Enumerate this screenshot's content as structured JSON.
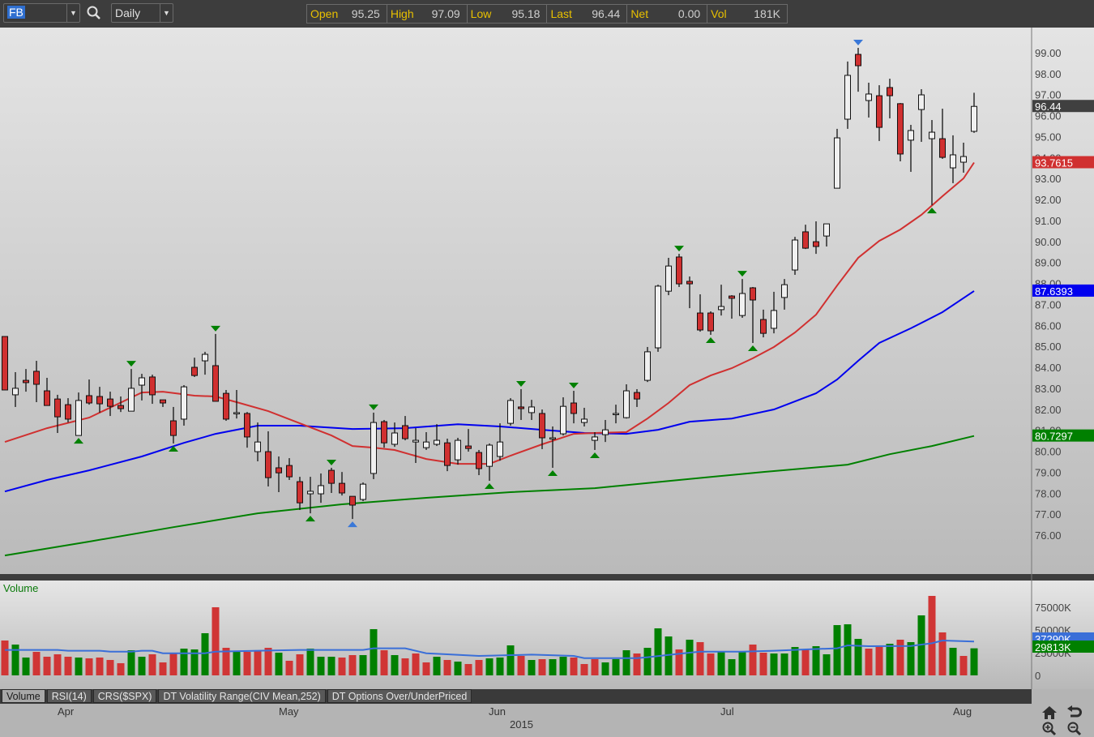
{
  "toolbar": {
    "symbol": "FB",
    "interval": "Daily",
    "quote": [
      {
        "label": "Open",
        "value": "95.25"
      },
      {
        "label": "High",
        "value": "97.09"
      },
      {
        "label": "Low",
        "value": "95.18"
      },
      {
        "label": "Last",
        "value": "96.44"
      },
      {
        "label": "Net",
        "value": "0.00"
      },
      {
        "label": "Vol",
        "value": "181K"
      }
    ]
  },
  "colors": {
    "up_candle": "#f0f0f0",
    "down_candle": "#d03030",
    "ma_fast": "#d03030",
    "ma_mid": "#0000ee",
    "ma_slow": "#008000",
    "vol_up": "#008000",
    "vol_down": "#d03535",
    "vol_ma": "#3a6fd8",
    "signal_green": "#008000",
    "signal_blue": "#3a78d8"
  },
  "chart_data": {
    "type": "candlestick",
    "symbol": "FB",
    "price_axis": {
      "ticks": [
        "99.00",
        "98.00",
        "97.00",
        "96.00",
        "95.00",
        "94.00",
        "93.00",
        "92.00",
        "91.00",
        "90.00",
        "89.00",
        "88.00",
        "87.00",
        "86.00",
        "85.00",
        "84.00",
        "83.00",
        "82.00",
        "81.00",
        "80.00",
        "79.00",
        "78.00",
        "77.00",
        "76.00"
      ],
      "range": [
        75.0,
        100.2
      ]
    },
    "x_axis": {
      "months": [
        "Apr",
        "May",
        "Jun",
        "Jul",
        "Aug"
      ],
      "year": "2015"
    },
    "badges": {
      "last": "96.44",
      "ma_fast": "93.7615",
      "ma_mid": "87.6393",
      "ma_slow": "80.7297",
      "vol_ma": "37290K",
      "vol_last": "29813K"
    },
    "ohlc": [
      [
        85.47,
        85.47,
        82.92,
        82.92
      ],
      [
        82.69,
        83.77,
        82.11,
        83.0
      ],
      [
        83.38,
        83.92,
        82.84,
        83.27
      ],
      [
        83.81,
        84.31,
        82.34,
        83.19
      ],
      [
        82.88,
        83.5,
        82.18,
        82.18
      ],
      [
        82.49,
        82.69,
        80.87,
        81.64
      ],
      [
        82.22,
        82.53,
        81.37,
        81.53
      ],
      [
        80.75,
        82.8,
        80.75,
        82.42
      ],
      [
        82.65,
        83.42,
        82.22,
        82.3
      ],
      [
        82.61,
        83.07,
        81.84,
        82.26
      ],
      [
        82.49,
        82.84,
        81.68,
        82.14
      ],
      [
        82.18,
        82.61,
        81.87,
        82.03
      ],
      [
        81.91,
        83.92,
        81.91,
        83.0
      ],
      [
        83.15,
        83.69,
        82.42,
        83.5
      ],
      [
        83.54,
        83.65,
        82.26,
        82.69
      ],
      [
        82.45,
        82.45,
        82.11,
        82.3
      ],
      [
        81.45,
        82.11,
        80.37,
        80.75
      ],
      [
        81.53,
        83.15,
        81.22,
        83.07
      ],
      [
        84.0,
        84.46,
        83.54,
        83.61
      ],
      [
        84.31,
        84.74,
        83.65,
        84.62
      ],
      [
        84.08,
        85.59,
        82.38,
        82.38
      ],
      [
        82.76,
        82.92,
        81.45,
        81.53
      ],
      [
        81.84,
        82.92,
        81.56,
        81.84
      ],
      [
        81.8,
        81.87,
        80.17,
        80.68
      ],
      [
        79.98,
        81.37,
        79.52,
        80.44
      ],
      [
        79.98,
        80.95,
        78.32,
        78.74
      ],
      [
        79.21,
        79.75,
        78.05,
        78.97
      ],
      [
        79.32,
        79.67,
        78.63,
        78.78
      ],
      [
        78.55,
        78.78,
        77.2,
        77.54
      ],
      [
        77.97,
        78.78,
        77.04,
        78.09
      ],
      [
        77.97,
        78.94,
        77.54,
        78.36
      ],
      [
        79.09,
        79.21,
        78.01,
        78.47
      ],
      [
        78.47,
        79.01,
        77.89,
        78.01
      ],
      [
        77.85,
        77.85,
        76.77,
        77.43
      ],
      [
        77.7,
        78.51,
        77.62,
        78.43
      ],
      [
        78.94,
        81.84,
        78.67,
        81.37
      ],
      [
        81.41,
        81.49,
        80.17,
        80.4
      ],
      [
        80.33,
        81.37,
        80.21,
        80.87
      ],
      [
        81.22,
        81.68,
        80.52,
        80.6
      ],
      [
        80.44,
        81.1,
        79.44,
        80.52
      ],
      [
        80.17,
        80.91,
        80.06,
        80.44
      ],
      [
        80.33,
        81.29,
        80.25,
        80.52
      ],
      [
        80.4,
        80.6,
        79.05,
        79.32
      ],
      [
        79.59,
        80.64,
        79.36,
        80.52
      ],
      [
        80.25,
        81.06,
        79.98,
        80.13
      ],
      [
        79.94,
        80.06,
        78.86,
        79.17
      ],
      [
        79.28,
        80.37,
        78.59,
        80.29
      ],
      [
        79.75,
        81.33,
        79.55,
        80.44
      ],
      [
        81.33,
        82.53,
        81.22,
        82.42
      ],
      [
        82.11,
        82.96,
        81.49,
        82.03
      ],
      [
        81.84,
        82.45,
        81.49,
        82.11
      ],
      [
        81.8,
        81.99,
        80.1,
        80.64
      ],
      [
        80.64,
        81.18,
        79.21,
        80.64
      ],
      [
        80.83,
        82.57,
        80.75,
        82.14
      ],
      [
        82.3,
        82.88,
        81.33,
        81.8
      ],
      [
        81.37,
        82.07,
        81.18,
        81.53
      ],
      [
        80.52,
        80.91,
        80.06,
        80.68
      ],
      [
        80.79,
        81.49,
        80.44,
        81.02
      ],
      [
        81.8,
        82.22,
        81.33,
        81.8
      ],
      [
        81.6,
        83.19,
        81.56,
        82.88
      ],
      [
        82.8,
        82.96,
        82.11,
        82.49
      ],
      [
        83.38,
        84.97,
        83.3,
        84.74
      ],
      [
        84.93,
        87.94,
        84.74,
        87.87
      ],
      [
        87.63,
        89.22,
        87.44,
        88.83
      ],
      [
        89.26,
        89.41,
        87.83,
        87.98
      ],
      [
        88.1,
        88.33,
        86.82,
        87.98
      ],
      [
        86.59,
        87.48,
        85.7,
        85.78
      ],
      [
        86.59,
        86.67,
        85.55,
        85.74
      ],
      [
        86.75,
        87.94,
        86.47,
        86.9
      ],
      [
        87.4,
        87.44,
        86.32,
        87.29
      ],
      [
        86.47,
        88.21,
        86.36,
        87.52
      ],
      [
        87.79,
        87.83,
        85.16,
        87.21
      ],
      [
        86.28,
        86.75,
        85.43,
        85.62
      ],
      [
        85.86,
        87.6,
        85.62,
        86.71
      ],
      [
        87.33,
        88.21,
        86.75,
        87.94
      ],
      [
        88.64,
        90.22,
        88.41,
        90.07
      ],
      [
        90.46,
        90.8,
        89.64,
        89.68
      ],
      [
        89.99,
        90.96,
        89.41,
        89.76
      ],
      [
        90.26,
        90.84,
        89.76,
        90.84
      ],
      [
        92.54,
        95.37,
        92.54,
        94.94
      ],
      [
        95.83,
        98.58,
        95.37,
        97.92
      ],
      [
        98.92,
        99.23,
        97.14,
        98.38
      ],
      [
        96.72,
        97.57,
        95.91,
        97.03
      ],
      [
        96.95,
        97.45,
        94.79,
        95.44
      ],
      [
        97.34,
        97.76,
        95.87,
        96.95
      ],
      [
        96.57,
        96.6,
        93.82,
        94.17
      ],
      [
        94.83,
        95.56,
        93.32,
        95.29
      ],
      [
        96.29,
        97.26,
        94.75,
        96.99
      ],
      [
        94.9,
        95.79,
        91.73,
        95.21
      ],
      [
        94.9,
        96.33,
        93.94,
        94.01
      ],
      [
        93.51,
        95.06,
        92.78,
        94.13
      ],
      [
        93.78,
        94.71,
        93.28,
        94.05
      ],
      [
        95.25,
        97.09,
        95.18,
        96.44
      ]
    ],
    "signals": {
      "top_green": [
        12,
        20,
        31,
        35,
        49,
        54,
        64,
        70
      ],
      "top_blue": [
        81
      ],
      "bottom_green": [
        7,
        16,
        29,
        46,
        52,
        56,
        67,
        71,
        88
      ],
      "bottom_blue": [
        33
      ]
    },
    "moving_averages": {
      "fast": [
        [
          0,
          80.44
        ],
        [
          4,
          81.1
        ],
        [
          8,
          81.6
        ],
        [
          13,
          82.8
        ],
        [
          15,
          82.84
        ],
        [
          18,
          82.65
        ],
        [
          20,
          82.61
        ],
        [
          22,
          82.34
        ],
        [
          25,
          81.91
        ],
        [
          28,
          81.33
        ],
        [
          31,
          80.75
        ],
        [
          33,
          80.25
        ],
        [
          35,
          80.17
        ],
        [
          37,
          80.06
        ],
        [
          40,
          79.63
        ],
        [
          43,
          79.4
        ],
        [
          46,
          79.4
        ],
        [
          48,
          79.79
        ],
        [
          51,
          80.33
        ],
        [
          54,
          80.83
        ],
        [
          56,
          80.87
        ],
        [
          59,
          80.91
        ],
        [
          61,
          81.56
        ],
        [
          63,
          82.3
        ],
        [
          65,
          83.15
        ],
        [
          67,
          83.61
        ],
        [
          69,
          83.96
        ],
        [
          71,
          84.43
        ],
        [
          73,
          84.97
        ],
        [
          75,
          85.66
        ],
        [
          77,
          86.51
        ],
        [
          79,
          87.9
        ],
        [
          81,
          89.22
        ],
        [
          83,
          90.03
        ],
        [
          85,
          90.57
        ],
        [
          87,
          91.27
        ],
        [
          89,
          92.16
        ],
        [
          91,
          93.01
        ],
        [
          92,
          93.7615
        ]
      ],
      "mid": [
        [
          0,
          78.08
        ],
        [
          4,
          78.63
        ],
        [
          8,
          79.09
        ],
        [
          13,
          79.75
        ],
        [
          17,
          80.4
        ],
        [
          20,
          80.83
        ],
        [
          24,
          81.22
        ],
        [
          28,
          81.22
        ],
        [
          33,
          81.06
        ],
        [
          38,
          81.1
        ],
        [
          43,
          81.29
        ],
        [
          47,
          81.18
        ],
        [
          51,
          81.02
        ],
        [
          55,
          80.87
        ],
        [
          59,
          80.83
        ],
        [
          62,
          81.02
        ],
        [
          65,
          81.41
        ],
        [
          69,
          81.56
        ],
        [
          73,
          81.99
        ],
        [
          77,
          82.76
        ],
        [
          79,
          83.42
        ],
        [
          81,
          84.31
        ],
        [
          83,
          85.16
        ],
        [
          86,
          85.86
        ],
        [
          89,
          86.63
        ],
        [
          92,
          87.6393
        ]
      ],
      "slow": [
        [
          0,
          75.03
        ],
        [
          8,
          75.69
        ],
        [
          16,
          76.38
        ],
        [
          24,
          77.04
        ],
        [
          32,
          77.47
        ],
        [
          40,
          77.78
        ],
        [
          48,
          78.05
        ],
        [
          56,
          78.24
        ],
        [
          64,
          78.63
        ],
        [
          72,
          79.01
        ],
        [
          80,
          79.36
        ],
        [
          84,
          79.86
        ],
        [
          88,
          80.25
        ],
        [
          92,
          80.7297
        ]
      ]
    },
    "volume": {
      "title": "Volume",
      "ticks": [
        "75000K",
        "50000K",
        "25000K",
        "0"
      ],
      "values_k": [
        38400,
        33940,
        19650,
        25900,
        20540,
        23220,
        20540,
        19650,
        18760,
        19650,
        16970,
        13400,
        27690,
        20540,
        23220,
        14290,
        24110,
        29470,
        28580,
        46440,
        75020,
        30370,
        25900,
        25900,
        27690,
        30370,
        25010,
        16080,
        23220,
        29470,
        20540,
        20540,
        19650,
        22330,
        22330,
        50910,
        27690,
        22330,
        18760,
        24110,
        14290,
        20540,
        16970,
        15180,
        12500,
        16970,
        18760,
        19650,
        33040,
        21430,
        16970,
        17860,
        17860,
        20540,
        19650,
        12500,
        17860,
        14290,
        17860,
        27690,
        24110,
        30370,
        51800,
        42870,
        28580,
        39300,
        36620,
        24110,
        25900,
        17860,
        25900,
        33940,
        25010,
        24110,
        24110,
        31260,
        28580,
        32150,
        23220,
        55370,
        56270,
        40190,
        29470,
        31260,
        34830,
        39300,
        36620,
        66090,
        87520,
        47330,
        30370,
        21430,
        29813
      ],
      "up": [
        0,
        1,
        1,
        0,
        0,
        0,
        0,
        1,
        0,
        0,
        0,
        0,
        1,
        1,
        0,
        0,
        0,
        1,
        1,
        1,
        0,
        0,
        1,
        0,
        0,
        0,
        1,
        0,
        0,
        1,
        1,
        1,
        0,
        0,
        1,
        1,
        0,
        1,
        0,
        0,
        0,
        1,
        0,
        1,
        0,
        0,
        1,
        1,
        1,
        0,
        1,
        0,
        1,
        1,
        0,
        0,
        0,
        1,
        1,
        1,
        0,
        1,
        1,
        1,
        0,
        1,
        0,
        0,
        1,
        1,
        1,
        0,
        0,
        1,
        1,
        1,
        0,
        1,
        1,
        1,
        1,
        1,
        0,
        0,
        1,
        0,
        1,
        1,
        0,
        0,
        1,
        0,
        1
      ],
      "ma_k": [
        [
          0,
          28000
        ],
        [
          5,
          28000
        ],
        [
          6,
          27100
        ],
        [
          9,
          27100
        ],
        [
          10,
          26200
        ],
        [
          12,
          26200
        ],
        [
          13,
          27100
        ],
        [
          14,
          27100
        ],
        [
          15,
          24400
        ],
        [
          19,
          24400
        ],
        [
          20,
          26200
        ],
        [
          24,
          27100
        ],
        [
          28,
          28000
        ],
        [
          34,
          28000
        ],
        [
          35,
          29800
        ],
        [
          38,
          29800
        ],
        [
          40,
          24400
        ],
        [
          42,
          23200
        ],
        [
          45,
          21400
        ],
        [
          47,
          22000
        ],
        [
          50,
          22900
        ],
        [
          54,
          21400
        ],
        [
          55,
          19050
        ],
        [
          60,
          19050
        ],
        [
          61,
          20000
        ],
        [
          63,
          22600
        ],
        [
          65,
          25000
        ],
        [
          66,
          26200
        ],
        [
          70,
          26200
        ],
        [
          73,
          27100
        ],
        [
          76,
          28600
        ],
        [
          79,
          29800
        ],
        [
          80,
          33000
        ],
        [
          82,
          32150
        ],
        [
          86,
          32450
        ],
        [
          88,
          35400
        ],
        [
          89,
          38400
        ],
        [
          92,
          37290
        ]
      ]
    }
  },
  "tabs": [
    "Volume",
    "RSI(14)",
    "CRS($SPX)",
    "DT Volatility Range(CIV Mean,252)",
    "DT Options Over/UnderPriced"
  ],
  "icons": [
    "search-icon",
    "home-icon",
    "undo-icon",
    "zoom-in-icon",
    "zoom-out-icon"
  ]
}
